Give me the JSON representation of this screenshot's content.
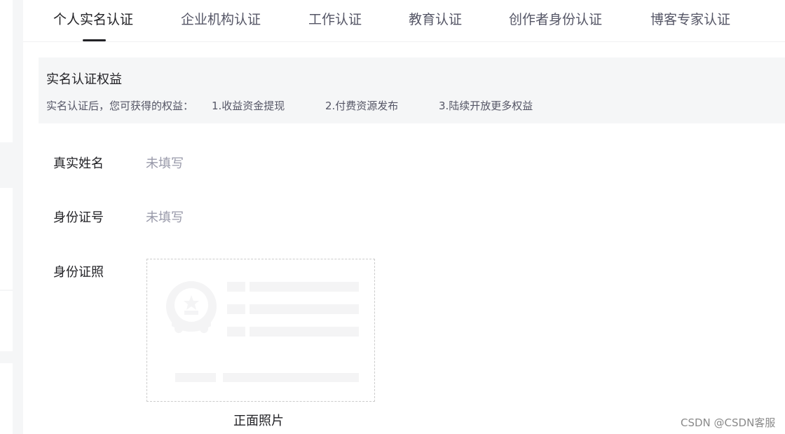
{
  "tabs": [
    {
      "label": "个人实名认证",
      "active": true
    },
    {
      "label": "企业机构认证",
      "active": false
    },
    {
      "label": "工作认证",
      "active": false
    },
    {
      "label": "教育认证",
      "active": false
    },
    {
      "label": "创作者身份认证",
      "active": false
    },
    {
      "label": "博客专家认证",
      "active": false
    }
  ],
  "benefits": {
    "title": "实名认证权益",
    "desc": "实名认证后，您可获得的权益：",
    "items": [
      "1.收益资金提现",
      "2.付费资源发布",
      "3.陆续开放更多权益"
    ]
  },
  "form": {
    "real_name": {
      "label": "真实姓名",
      "value": "未填写"
    },
    "id_number": {
      "label": "身份证号",
      "value": "未填写"
    },
    "id_photo": {
      "label": "身份证照",
      "caption": "正面照片"
    }
  },
  "watermark": "CSDN @CSDN客服",
  "colors": {
    "text_primary": "#222226",
    "text_secondary": "#555666",
    "text_placeholder": "#999aaa",
    "panel_bg": "#f5f6f7"
  }
}
